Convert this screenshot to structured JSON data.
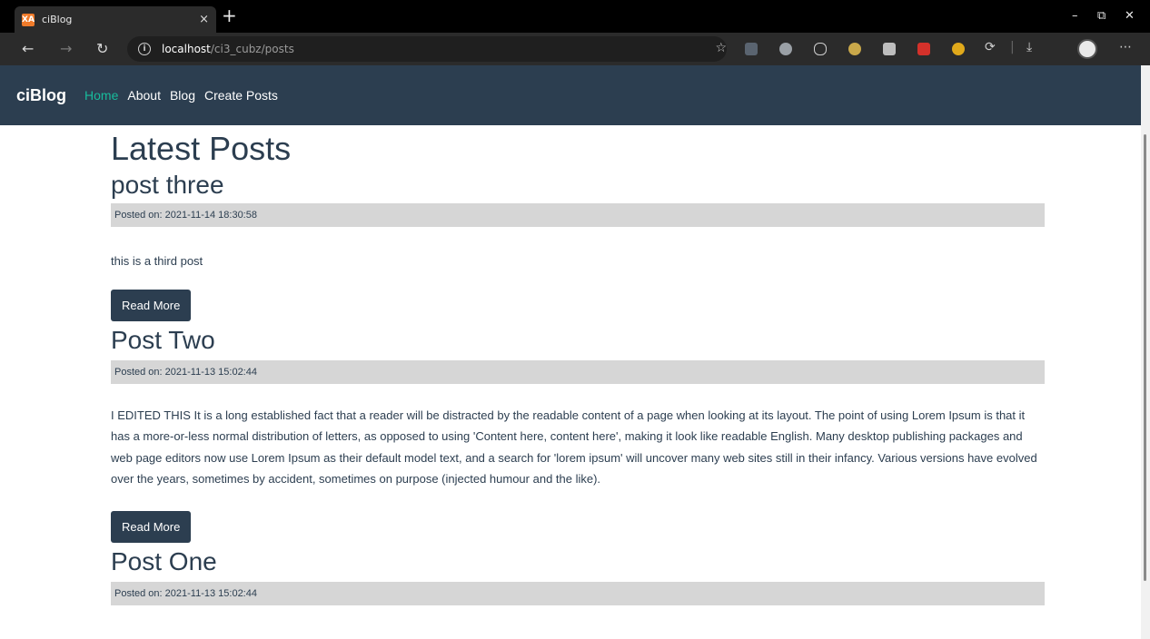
{
  "browser": {
    "tab_favicon": "XA",
    "tab_title": "ciBlog",
    "tab_close": "×",
    "new_tab": "+",
    "url_host": "localhost",
    "url_path": "/ci3_cubz/posts",
    "icons": [
      "back-icon",
      "forward-icon",
      "refresh-icon",
      "info-icon",
      "favorite-icon",
      "downloads-icon",
      "profile-icon",
      "more-icon"
    ]
  },
  "navbar": {
    "brand": "ciBlog",
    "links": [
      {
        "label": "Home",
        "active": true
      },
      {
        "label": "About",
        "active": false
      },
      {
        "label": "Blog",
        "active": false
      },
      {
        "label": "Create Posts",
        "active": false
      }
    ]
  },
  "page": {
    "title": "Latest Posts"
  },
  "posts": [
    {
      "title": "post three",
      "posted_on": "Posted on: 2021-11-14 18:30:58",
      "body": "this is a third post",
      "button": "Read More"
    },
    {
      "title": "Post Two",
      "posted_on": "Posted on: 2021-11-13 15:02:44",
      "body": "I EDITED THIS It is a long established fact that a reader will be distracted by the readable content of a page when looking at its layout. The point of using Lorem Ipsum is that it has a more-or-less normal distribution of letters, as opposed to using 'Content here, content here', making it look like readable English. Many desktop publishing packages and web page editors now use Lorem Ipsum as their default model text, and a search for 'lorem ipsum' will uncover many web sites still in their infancy. Various versions have evolved over the years, sometimes by accident, sometimes on purpose (injected humour and the like).",
      "button": "Read More"
    },
    {
      "title": "Post One",
      "posted_on": "Posted on: 2021-11-13 15:02:44"
    }
  ],
  "colors": {
    "navbar": "#2c3e50",
    "active_link": "#18bc9c",
    "meta_bg": "#d6d6d6"
  }
}
